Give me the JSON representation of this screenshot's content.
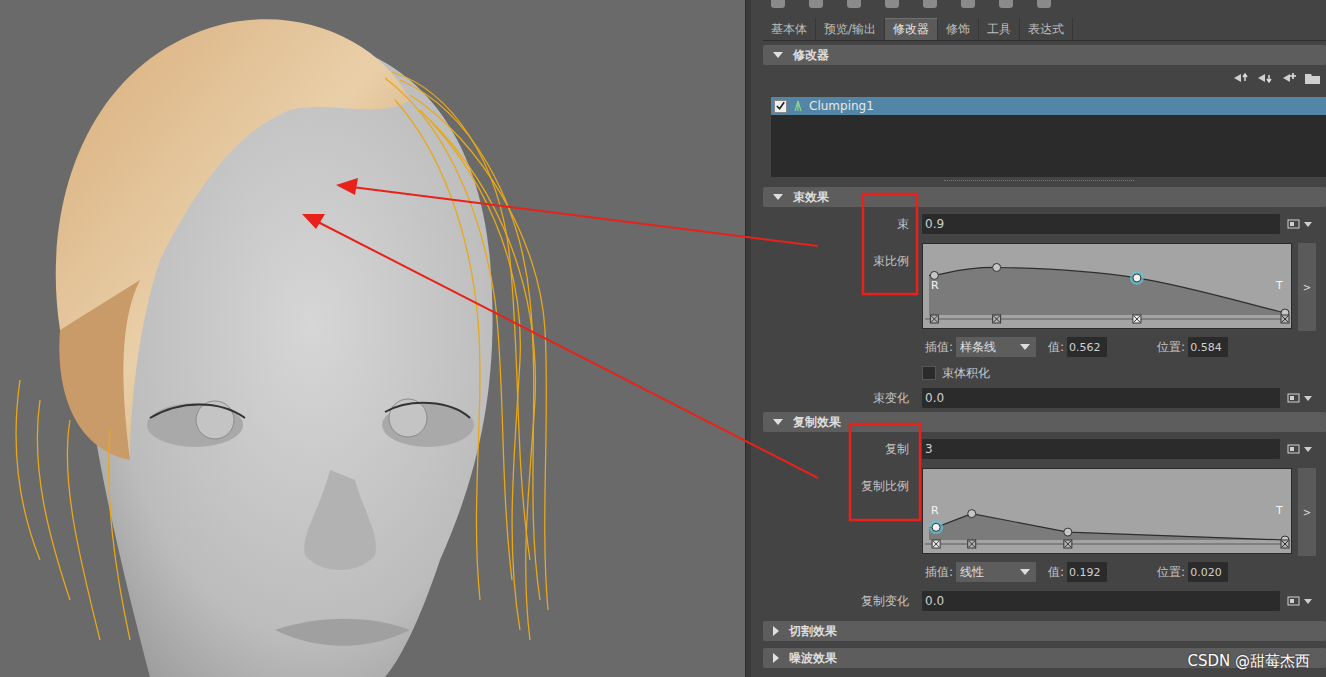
{
  "tabs": [
    {
      "label": "基本体",
      "selected": false
    },
    {
      "label": "预览/输出",
      "selected": false
    },
    {
      "label": "修改器",
      "selected": true
    },
    {
      "label": "修饰",
      "selected": false
    },
    {
      "label": "工具",
      "selected": false
    },
    {
      "label": "表达式",
      "selected": false
    }
  ],
  "modifier_panel": {
    "title": "修改器",
    "expanded": true
  },
  "modifiers": [
    {
      "name": "Clumping1",
      "enabled": true,
      "selected": true
    }
  ],
  "effect_sections": [
    {
      "title": "束效果",
      "expanded": true,
      "amount": {
        "label": "束",
        "value": "0.9"
      },
      "ramp": {
        "label": "束比例",
        "start_label": "R",
        "end_label": "T",
        "expand_button": ">",
        "interpolation_label": "插值:",
        "interpolation": "样条线",
        "interpolation_kind": "spline",
        "value_label": "值:",
        "value": "0.562",
        "position_label": "位置:",
        "position": "0.584",
        "points": [
          {
            "x": 0.015,
            "y": 0.6,
            "selected": false
          },
          {
            "x": 0.19,
            "y": 0.72,
            "selected": false
          },
          {
            "x": 0.584,
            "y": 0.562,
            "selected": true
          },
          {
            "x": 1,
            "y": 0.03,
            "selected": false
          }
        ]
      },
      "option": {
        "label": "束体积化",
        "checked": false
      },
      "variation": {
        "label": "束变化",
        "value": "0.0"
      }
    },
    {
      "title": "复制效果",
      "expanded": true,
      "amount": {
        "label": "复制",
        "value": "3"
      },
      "ramp": {
        "label": "复制比例",
        "start_label": "R",
        "end_label": "T",
        "expand_button": ">",
        "interpolation_label": "插值:",
        "interpolation": "线性",
        "interpolation_kind": "linear",
        "value_label": "值:",
        "value": "0.192",
        "position_label": "位置:",
        "position": "0.020",
        "points": [
          {
            "x": 0.02,
            "y": 0.192,
            "selected": true
          },
          {
            "x": 0.12,
            "y": 0.4,
            "selected": false
          },
          {
            "x": 0.39,
            "y": 0.12,
            "selected": false
          },
          {
            "x": 1,
            "y": 0.0,
            "selected": false
          }
        ]
      },
      "variation": {
        "label": "复制变化",
        "value": "0.0"
      }
    }
  ],
  "collapsed_sections": [
    {
      "title": "切割效果",
      "expanded": false
    },
    {
      "title": "噪波效果",
      "expanded": false
    }
  ],
  "watermark": "CSDN @甜莓杰西"
}
